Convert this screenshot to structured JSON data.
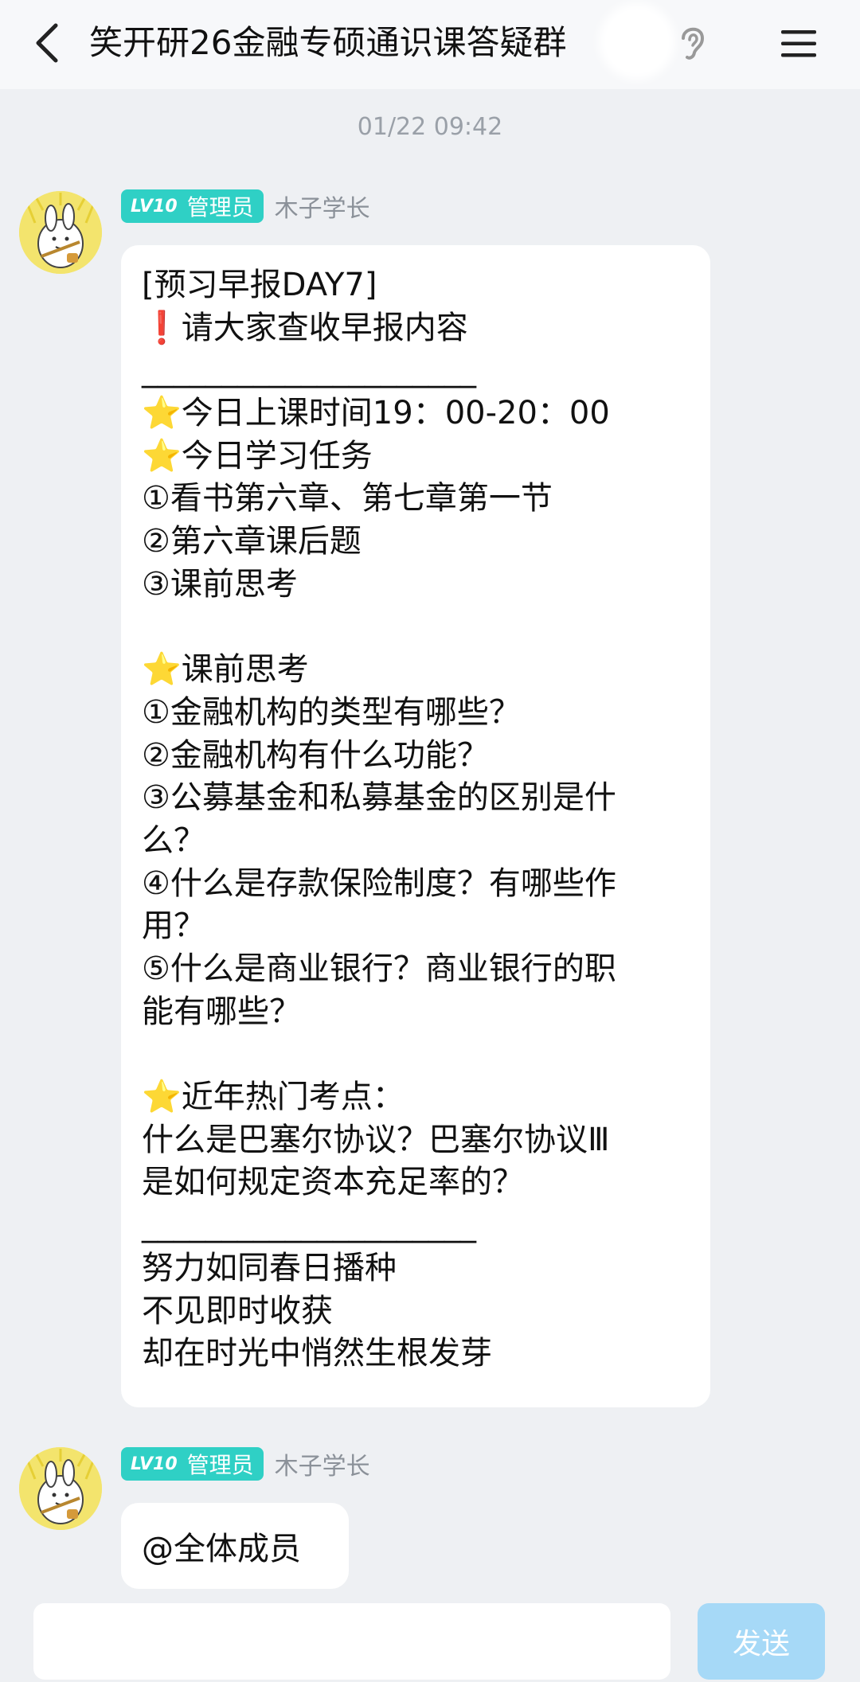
{
  "header": {
    "title": "笑开研26金融专硕通识课答疑群"
  },
  "timestamp": "01/22 09:42",
  "messages": [
    {
      "badge_level": "LV10",
      "badge_role": "管理员",
      "sender": "木子学长",
      "lines": [
        "[预习早报DAY7]",
        "❗请大家查收早报内容",
        "_____________________",
        "⭐今日上课时间19：00-20：00",
        "⭐今日学习任务",
        "①看书第六章、第七章第一节",
        "②第六章课后题",
        "③课前思考",
        "",
        "⭐课前思考",
        "①金融机构的类型有哪些？",
        "②金融机构有什么功能？",
        "③公募基金和私募基金的区别是什",
        "么？",
        "④什么是存款保险制度？有哪些作",
        "用？",
        "⑤什么是商业银行？商业银行的职",
        "能有哪些？",
        "",
        "⭐近年热门考点：",
        "什么是巴塞尔协议？巴塞尔协议Ⅲ",
        "是如何规定资本充足率的？",
        "_____________________",
        "努力如同春日播种",
        "不见即时收获",
        "却在时光中悄然生根发芽"
      ]
    },
    {
      "badge_level": "LV10",
      "badge_role": "管理员",
      "sender": "木子学长",
      "text": "@全体成员"
    }
  ],
  "input": {
    "value": "",
    "send_label": "发送"
  },
  "colors": {
    "badge": "#2fd0c5",
    "send_button": "#a6d9f7",
    "background": "#eef0f3"
  }
}
